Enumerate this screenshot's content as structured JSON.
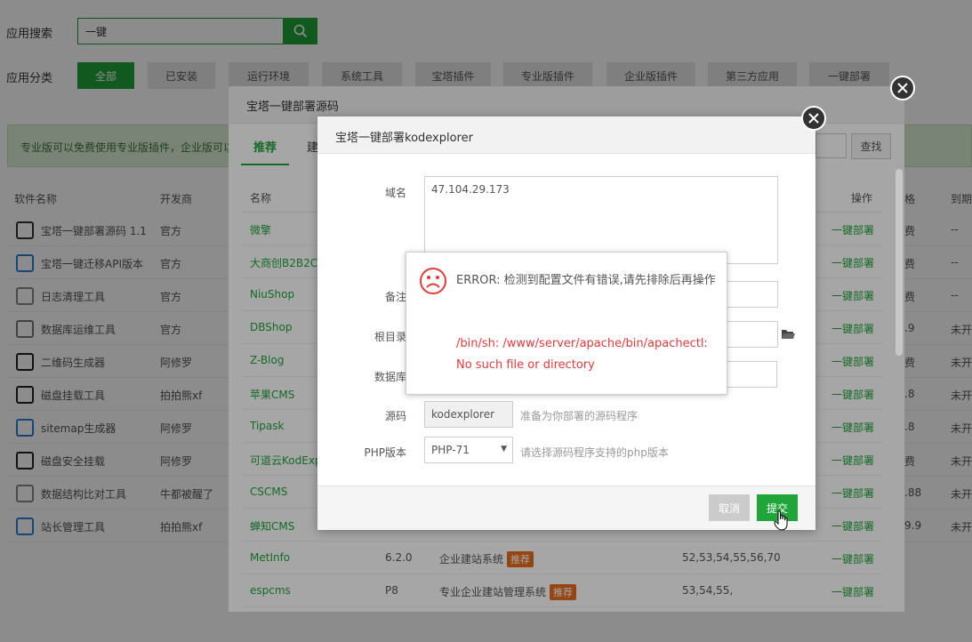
{
  "search": {
    "label": "应用搜索",
    "value": "一键"
  },
  "category": {
    "label": "应用分类",
    "items": [
      "全部",
      "已安装",
      "运行环境",
      "系统工具",
      "宝塔插件",
      "专业版插件",
      "企业版插件",
      "第三方应用",
      "一键部署"
    ]
  },
  "notice": "专业版可以免费使用专业版插件，企业版可以",
  "bg_table": {
    "headers": [
      "软件名称",
      "开发商"
    ],
    "right_headers": [
      "格",
      "到期"
    ],
    "rows": [
      {
        "name": "宝塔一键部署源码 1.1",
        "dev": "官方",
        "c1": "费",
        "c2": "--"
      },
      {
        "name": "宝塔一键迁移API版本",
        "dev": "官方",
        "c1": "费",
        "c2": "--"
      },
      {
        "name": "日志清理工具",
        "dev": "官方",
        "c1": "费",
        "c2": "--"
      },
      {
        "name": "数据库运维工具",
        "dev": "官方",
        "c1": ".9",
        "c2": "未开"
      },
      {
        "name": "二维码生成器",
        "dev": "阿修罗",
        "c1": "费",
        "c2": "未开"
      },
      {
        "name": "磁盘挂载工具",
        "dev": "拍拍熊xf",
        "c1": ".8",
        "c2": "未开"
      },
      {
        "name": "sitemap生成器",
        "dev": "阿修罗",
        "c1": ".8",
        "c2": "未开"
      },
      {
        "name": "磁盘安全挂载",
        "dev": "阿修罗",
        "c1": "费",
        "c2": "未开"
      },
      {
        "name": "数据结构比对工具",
        "dev": "牛都被醒了",
        "c1": ".88",
        "c2": "未开"
      },
      {
        "name": "站长管理工具",
        "dev": "拍拍熊xf",
        "c1": "9.9",
        "c2": "未开"
      }
    ]
  },
  "modal1": {
    "title": "宝塔一键部署源码",
    "tabs": [
      "推荐",
      "建"
    ],
    "find_label": "查找",
    "headers": {
      "name": "名称",
      "op": "操作"
    },
    "rows": [
      {
        "name": "微擎",
        "op": "一键部署"
      },
      {
        "name": "大商创B2B2C多",
        "op": "一键部署"
      },
      {
        "name": "NiuShop",
        "op": "一键部署"
      },
      {
        "name": "DBShop",
        "op": "一键部署"
      },
      {
        "name": "Z-Blog",
        "op": "一键部署"
      },
      {
        "name": "苹果CMS",
        "op": "一键部署"
      },
      {
        "name": "Tipask",
        "op": "一键部署"
      },
      {
        "name": "可道云KodExp",
        "op": "一键部署"
      },
      {
        "name": "CSCMS",
        "op": "一键部署"
      },
      {
        "name": "蝉知CMS",
        "op": "一键部署"
      },
      {
        "name": "MetInfo",
        "ver": "6.2.0",
        "desc": "企业建站系统",
        "tag": "推荐",
        "php": "52,53,54,55,56,70",
        "op": "一键部署"
      },
      {
        "name": "espcms",
        "ver": "P8",
        "desc": "专业企业建站管理系统",
        "tag": "推荐",
        "php": "53,54,55,",
        "op": "一键部署"
      }
    ]
  },
  "modal2": {
    "title": "宝塔一键部署kodexplorer",
    "domain_label": "域名",
    "domain_value": "47.104.29.173",
    "remark_label": "备注",
    "root_label": "根目录",
    "db_label": "数据库",
    "source_label": "源码",
    "source_value": "kodexplorer",
    "source_hint": "准备为你部署的源码程序",
    "php_label": "PHP版本",
    "php_value": "PHP-71",
    "php_hint": "请选择源码程序支持的php版本",
    "cancel_label": "取消",
    "submit_label": "提交"
  },
  "error": {
    "title": "ERROR: 检测到配置文件有错误,请先排除后再操作",
    "detail": "/bin/sh: /www/server/apache/bin/apachectl: No such file or directory"
  },
  "colors": {
    "accent": "#20a53a",
    "error": "#e23b3b",
    "tag": "#e56a1c"
  }
}
